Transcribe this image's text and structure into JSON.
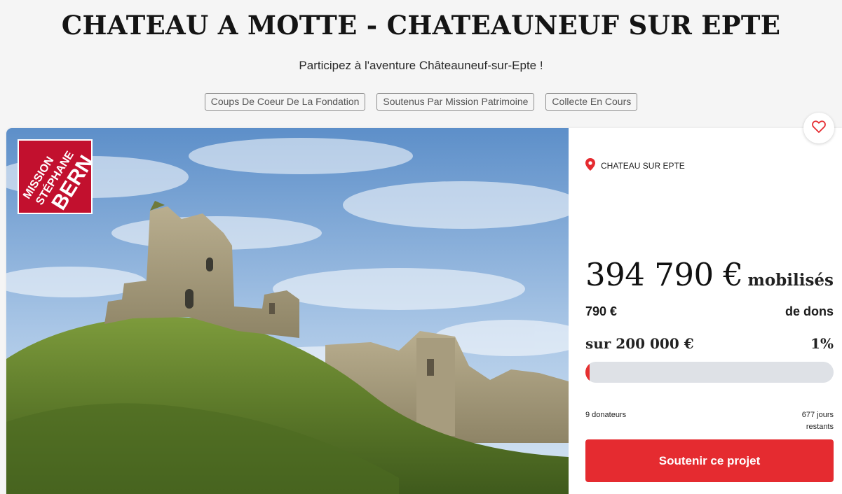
{
  "project": {
    "title": "CHATEAU A MOTTE - CHATEAUNEUF SUR EPTE",
    "subtitle": "Participez à l'aventure Châteauneuf-sur-Epte !"
  },
  "tags": [
    {
      "label": "Coups De Coeur De La Fondation"
    },
    {
      "label": "Soutenus Par Mission Patrimoine"
    },
    {
      "label": "Collecte En Cours"
    }
  ],
  "badge": {
    "text_lines": [
      "MISSION",
      "STÉPHANE",
      "BERN"
    ],
    "color": "#c2102e"
  },
  "panel": {
    "location": "CHATEAU SUR EPTE",
    "location_icon": "map-pin-icon",
    "favorite_icon": "heart-icon",
    "amount": "394 790 €",
    "amount_suffix": "mobilisés",
    "donations_amount": "790 €",
    "donations_label": "de dons",
    "goal": "sur 200 000 €",
    "percent": "1%",
    "progress_fraction": 0.01,
    "donors": "9 donateurs",
    "days_left_line1": "677 jours",
    "days_left_line2": "restants",
    "cta_label": "Soutenir ce projet"
  },
  "colors": {
    "accent": "#e52b30",
    "badge": "#c2102e",
    "progress_track": "#dee1e6"
  }
}
